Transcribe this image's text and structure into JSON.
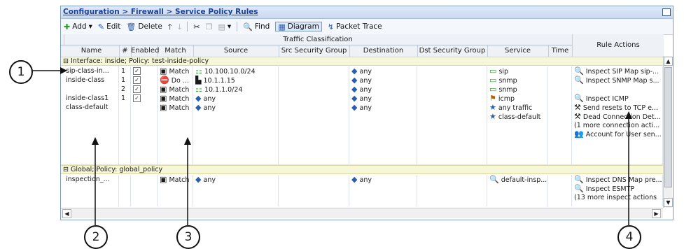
{
  "breadcrumb": "Configuration > Firewall > Service Policy Rules",
  "toolbar": {
    "add": "Add",
    "edit": "Edit",
    "delete": "Delete",
    "find": "Find",
    "diagram": "Diagram",
    "packet_trace": "Packet Trace"
  },
  "header": {
    "group": "Traffic Classification",
    "rule_actions": "Rule Actions",
    "columns": [
      "Name",
      "#",
      "Enabled",
      "Match",
      "Source",
      "Src Security Group",
      "Destination",
      "Dst Security Group",
      "Service",
      "Time"
    ]
  },
  "group1": "Interface: inside; Policy: test-inside-policy",
  "group2": "Global; Policy: global_policy",
  "rows": [
    {
      "name": "sip-class-in...",
      "num": "1",
      "enabled": "✓",
      "match": "Match",
      "source": "10.100.10.0/24",
      "dest": "any",
      "service": "sip",
      "actions": [
        "Inspect SIP Map sip-..."
      ]
    },
    {
      "name": "inside-class",
      "num": "1",
      "enabled": "✓",
      "match": "Do ...",
      "source": "10.1.1.15",
      "dest": "any",
      "service": "snmp",
      "actions": [
        "Inspect SNMP Map s..."
      ]
    },
    {
      "name": "",
      "num": "2",
      "enabled": "✓",
      "match": "Match",
      "source": "10.1.1.0/24",
      "dest": "any",
      "service": "snmp",
      "actions": []
    },
    {
      "name": "inside-class1",
      "num": "1",
      "enabled": "✓",
      "match": "Match",
      "source": "any",
      "dest": "any",
      "service": "icmp",
      "actions": [
        "Inspect ICMP"
      ]
    },
    {
      "name": "class-default",
      "num": "",
      "enabled": "",
      "match": "Match",
      "source": "any",
      "dest": "any",
      "service": "any traffic",
      "service2": "class-default",
      "actions": [
        "Send resets to TCP e...",
        "Dead Connection Det...",
        "(1 more connection acti...",
        "Account for User sen..."
      ]
    },
    {
      "name": "inspection_...",
      "num": "",
      "enabled": "",
      "match": "Match",
      "source": "any",
      "dest": "any",
      "service": "default-insp...",
      "actions": [
        "Inspect DNS Map pre...",
        "Inspect ESMTP",
        "(13 more inspect actions"
      ]
    }
  ],
  "callouts": [
    "1",
    "2",
    "3",
    "4"
  ],
  "figure_id": "373059"
}
